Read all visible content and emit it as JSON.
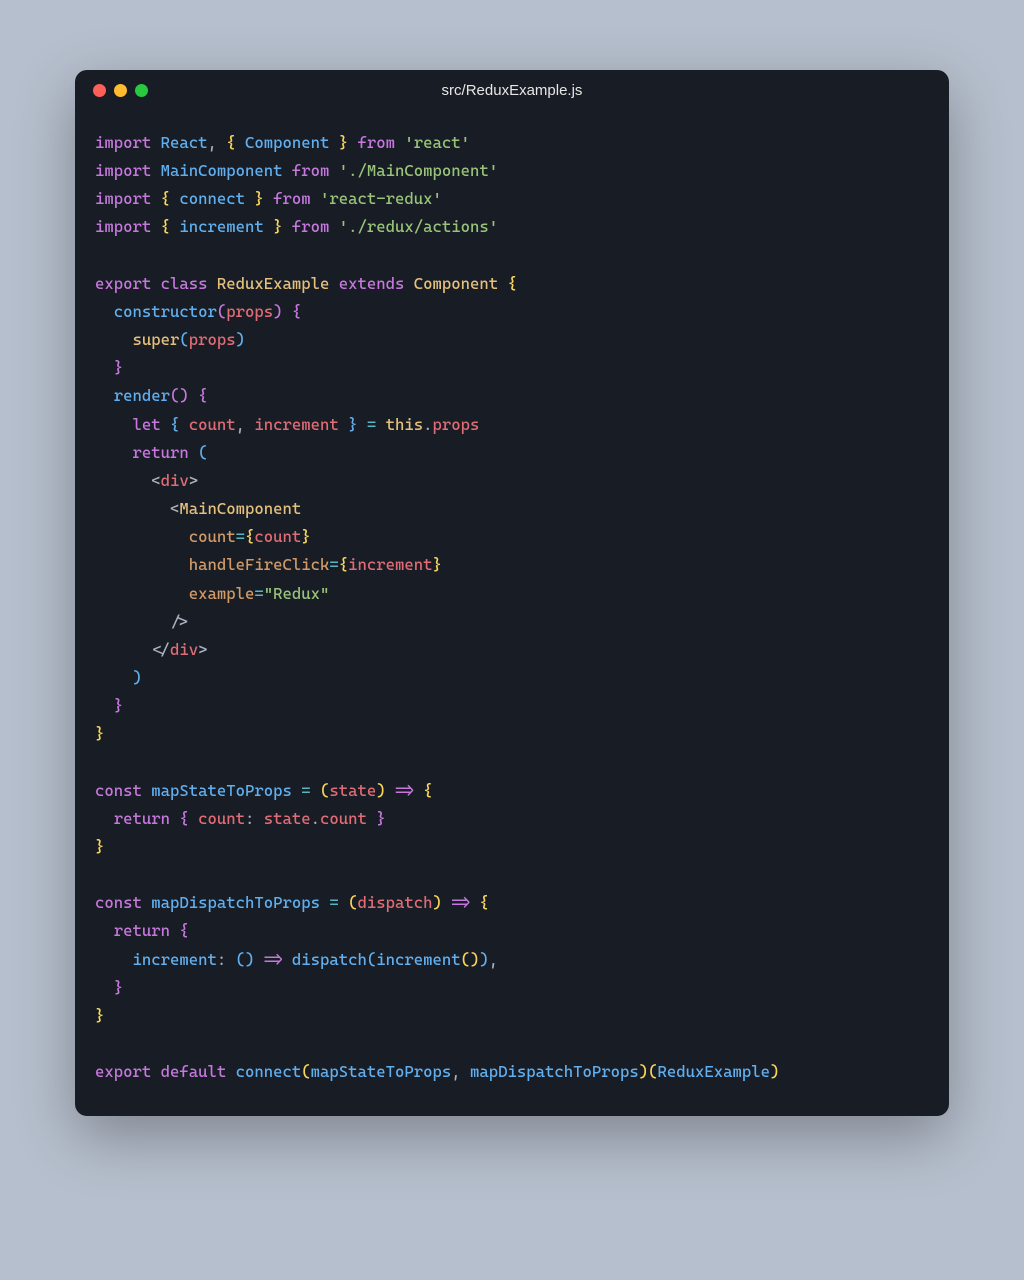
{
  "window": {
    "title": "src/ReduxExample.js"
  },
  "code": {
    "tokens": [
      [
        [
          "kw",
          "import"
        ],
        [
          "def",
          " "
        ],
        [
          "id",
          "React"
        ],
        [
          "pn",
          ", "
        ],
        [
          "brace1",
          "{"
        ],
        [
          "def",
          " "
        ],
        [
          "id",
          "Component"
        ],
        [
          "def",
          " "
        ],
        [
          "brace1",
          "}"
        ],
        [
          "def",
          " "
        ],
        [
          "kw",
          "from"
        ],
        [
          "def",
          " "
        ],
        [
          "str",
          "'react'"
        ]
      ],
      [
        [
          "kw",
          "import"
        ],
        [
          "def",
          " "
        ],
        [
          "id",
          "MainComponent"
        ],
        [
          "def",
          " "
        ],
        [
          "kw",
          "from"
        ],
        [
          "def",
          " "
        ],
        [
          "str",
          "'./MainComponent'"
        ]
      ],
      [
        [
          "kw",
          "import"
        ],
        [
          "def",
          " "
        ],
        [
          "brace1",
          "{"
        ],
        [
          "def",
          " "
        ],
        [
          "id",
          "connect"
        ],
        [
          "def",
          " "
        ],
        [
          "brace1",
          "}"
        ],
        [
          "def",
          " "
        ],
        [
          "kw",
          "from"
        ],
        [
          "def",
          " "
        ],
        [
          "str",
          "'react-redux'"
        ]
      ],
      [
        [
          "kw",
          "import"
        ],
        [
          "def",
          " "
        ],
        [
          "brace1",
          "{"
        ],
        [
          "def",
          " "
        ],
        [
          "id",
          "increment"
        ],
        [
          "def",
          " "
        ],
        [
          "brace1",
          "}"
        ],
        [
          "def",
          " "
        ],
        [
          "kw",
          "from"
        ],
        [
          "def",
          " "
        ],
        [
          "str",
          "'./redux/actions'"
        ]
      ],
      [],
      [
        [
          "kw",
          "export"
        ],
        [
          "def",
          " "
        ],
        [
          "kw",
          "class"
        ],
        [
          "def",
          " "
        ],
        [
          "cls",
          "ReduxExample"
        ],
        [
          "def",
          " "
        ],
        [
          "kw",
          "extends"
        ],
        [
          "def",
          " "
        ],
        [
          "cls",
          "Component"
        ],
        [
          "def",
          " "
        ],
        [
          "brace1",
          "{"
        ]
      ],
      [
        [
          "def",
          "  "
        ],
        [
          "id",
          "constructor"
        ],
        [
          "paren2",
          "("
        ],
        [
          "prop",
          "props"
        ],
        [
          "paren2",
          ")"
        ],
        [
          "def",
          " "
        ],
        [
          "brace2",
          "{"
        ]
      ],
      [
        [
          "def",
          "    "
        ],
        [
          "cls",
          "super"
        ],
        [
          "paren3",
          "("
        ],
        [
          "prop",
          "props"
        ],
        [
          "paren3",
          ")"
        ]
      ],
      [
        [
          "def",
          "  "
        ],
        [
          "brace2",
          "}"
        ]
      ],
      [
        [
          "def",
          "  "
        ],
        [
          "id",
          "render"
        ],
        [
          "paren2",
          "("
        ],
        [
          "paren2",
          ")"
        ],
        [
          "def",
          " "
        ],
        [
          "brace2",
          "{"
        ]
      ],
      [
        [
          "def",
          "    "
        ],
        [
          "kw",
          "let"
        ],
        [
          "def",
          " "
        ],
        [
          "brace3",
          "{"
        ],
        [
          "def",
          " "
        ],
        [
          "prop",
          "count"
        ],
        [
          "pn",
          ", "
        ],
        [
          "prop",
          "increment"
        ],
        [
          "def",
          " "
        ],
        [
          "brace3",
          "}"
        ],
        [
          "def",
          " "
        ],
        [
          "op",
          "="
        ],
        [
          "def",
          " "
        ],
        [
          "this",
          "this"
        ],
        [
          "pn",
          "."
        ],
        [
          "prop",
          "props"
        ]
      ],
      [
        [
          "def",
          "    "
        ],
        [
          "kw",
          "return"
        ],
        [
          "def",
          " "
        ],
        [
          "paren3",
          "("
        ]
      ],
      [
        [
          "def",
          "      "
        ],
        [
          "tagbr",
          "<"
        ],
        [
          "tag",
          "div"
        ],
        [
          "tagbr",
          ">"
        ]
      ],
      [
        [
          "def",
          "        "
        ],
        [
          "tagbr",
          "<"
        ],
        [
          "cls",
          "MainComponent"
        ]
      ],
      [
        [
          "def",
          "          "
        ],
        [
          "attr",
          "count"
        ],
        [
          "op",
          "="
        ],
        [
          "brace1",
          "{"
        ],
        [
          "prop",
          "count"
        ],
        [
          "brace1",
          "}"
        ]
      ],
      [
        [
          "def",
          "          "
        ],
        [
          "attr",
          "handleFireClick"
        ],
        [
          "op",
          "="
        ],
        [
          "brace1",
          "{"
        ],
        [
          "prop",
          "increment"
        ],
        [
          "brace1",
          "}"
        ]
      ],
      [
        [
          "def",
          "          "
        ],
        [
          "attr",
          "example"
        ],
        [
          "op",
          "="
        ],
        [
          "str",
          "\"Redux\""
        ]
      ],
      [
        [
          "def",
          "        "
        ],
        [
          "tagbr",
          "/>"
        ]
      ],
      [
        [
          "def",
          "      "
        ],
        [
          "tagbr",
          "</"
        ],
        [
          "tag",
          "div"
        ],
        [
          "tagbr",
          ">"
        ]
      ],
      [
        [
          "def",
          "    "
        ],
        [
          "paren3",
          ")"
        ]
      ],
      [
        [
          "def",
          "  "
        ],
        [
          "brace2",
          "}"
        ]
      ],
      [
        [
          "brace1",
          "}"
        ]
      ],
      [],
      [
        [
          "kw",
          "const"
        ],
        [
          "def",
          " "
        ],
        [
          "id",
          "mapStateToProps"
        ],
        [
          "def",
          " "
        ],
        [
          "op",
          "="
        ],
        [
          "def",
          " "
        ],
        [
          "paren",
          "("
        ],
        [
          "prop",
          "state"
        ],
        [
          "paren",
          ")"
        ],
        [
          "def",
          " "
        ],
        [
          "kw",
          "=>"
        ],
        [
          "def",
          " "
        ],
        [
          "brace1",
          "{"
        ]
      ],
      [
        [
          "def",
          "  "
        ],
        [
          "kw",
          "return"
        ],
        [
          "def",
          " "
        ],
        [
          "brace2",
          "{"
        ],
        [
          "def",
          " "
        ],
        [
          "prop",
          "count"
        ],
        [
          "pn",
          ": "
        ],
        [
          "prop",
          "state"
        ],
        [
          "pn",
          "."
        ],
        [
          "prop",
          "count"
        ],
        [
          "def",
          " "
        ],
        [
          "brace2",
          "}"
        ]
      ],
      [
        [
          "brace1",
          "}"
        ]
      ],
      [],
      [
        [
          "kw",
          "const"
        ],
        [
          "def",
          " "
        ],
        [
          "id",
          "mapDispatchToProps"
        ],
        [
          "def",
          " "
        ],
        [
          "op",
          "="
        ],
        [
          "def",
          " "
        ],
        [
          "paren",
          "("
        ],
        [
          "prop",
          "dispatch"
        ],
        [
          "paren",
          ")"
        ],
        [
          "def",
          " "
        ],
        [
          "kw",
          "=>"
        ],
        [
          "def",
          " "
        ],
        [
          "brace1",
          "{"
        ]
      ],
      [
        [
          "def",
          "  "
        ],
        [
          "kw",
          "return"
        ],
        [
          "def",
          " "
        ],
        [
          "brace2",
          "{"
        ]
      ],
      [
        [
          "def",
          "    "
        ],
        [
          "id",
          "increment"
        ],
        [
          "pn",
          ": "
        ],
        [
          "paren3",
          "("
        ],
        [
          "paren3",
          ")"
        ],
        [
          "def",
          " "
        ],
        [
          "kw",
          "=>"
        ],
        [
          "def",
          " "
        ],
        [
          "id",
          "dispatch"
        ],
        [
          "paren3",
          "("
        ],
        [
          "id",
          "increment"
        ],
        [
          "brace1",
          "("
        ],
        [
          "brace1",
          ")"
        ],
        [
          "paren3",
          ")"
        ],
        [
          "pn",
          ","
        ]
      ],
      [
        [
          "def",
          "  "
        ],
        [
          "brace2",
          "}"
        ]
      ],
      [
        [
          "brace1",
          "}"
        ]
      ],
      [],
      [
        [
          "kw",
          "export"
        ],
        [
          "def",
          " "
        ],
        [
          "kw",
          "default"
        ],
        [
          "def",
          " "
        ],
        [
          "id",
          "connect"
        ],
        [
          "paren",
          "("
        ],
        [
          "id",
          "mapStateToProps"
        ],
        [
          "pn",
          ", "
        ],
        [
          "id",
          "mapDispatchToProps"
        ],
        [
          "paren",
          ")"
        ],
        [
          "paren",
          "("
        ],
        [
          "id",
          "ReduxExample"
        ],
        [
          "paren",
          ")"
        ]
      ]
    ]
  }
}
